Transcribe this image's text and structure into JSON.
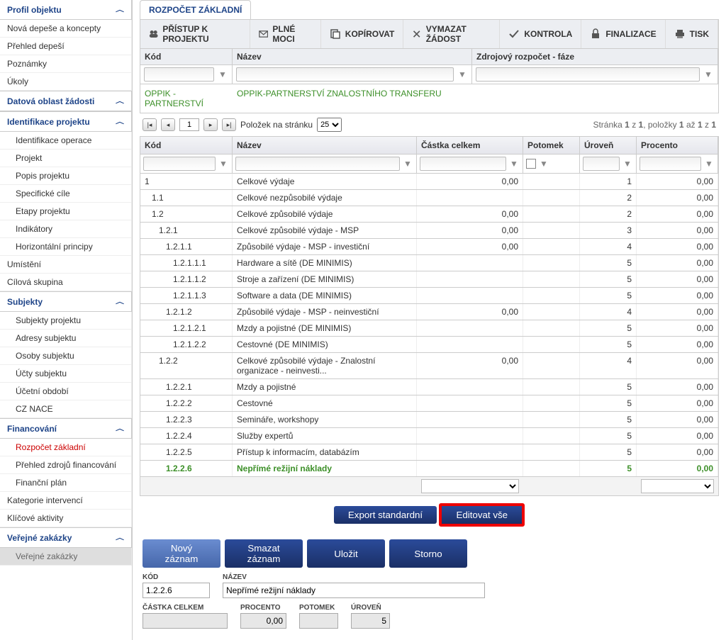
{
  "sidebar": {
    "sections": [
      {
        "label": "Profil objektu",
        "collapsible": true
      },
      {
        "items": [
          "Nová depeše a koncepty",
          "Přehled depeší",
          "Poznámky",
          "Úkoly"
        ]
      },
      {
        "label": "Datová oblast žádosti",
        "collapsible": true
      },
      {
        "label": "Identifikace projektu",
        "collapsible": true,
        "subitems": [
          "Identifikace operace",
          "Projekt",
          "Popis projektu",
          "Specifické cíle",
          "Etapy projektu",
          "Indikátory",
          "Horizontální principy"
        ]
      },
      {
        "plain": [
          "Umístění",
          "Cílová skupina"
        ]
      },
      {
        "label": "Subjekty",
        "collapsible": true,
        "subitems": [
          "Subjekty projektu",
          "Adresy subjektu",
          "Osoby subjektu",
          "Účty subjektu",
          "Účetní období",
          "CZ NACE"
        ]
      },
      {
        "label": "Financování",
        "collapsible": true,
        "subitems_html": [
          {
            "text": "Rozpočet základní",
            "active": true
          },
          {
            "text": "Přehled zdrojů financování"
          },
          {
            "text": "Finanční plán"
          }
        ]
      },
      {
        "plain": [
          "Kategorie intervencí",
          "Klíčové aktivity"
        ]
      },
      {
        "label": "Veřejné zakázky",
        "collapsible": true,
        "subitems_gray": [
          "Veřejné zakázky"
        ]
      }
    ]
  },
  "main": {
    "tab": "ROZPOČET ZÁKLADNÍ",
    "toolbar": [
      {
        "label": "PŘÍSTUP K PROJEKTU",
        "icon": "group"
      },
      {
        "label": "PLNÉ MOCI",
        "icon": "mail"
      },
      {
        "label": "KOPÍROVAT",
        "icon": "copy"
      },
      {
        "label": "VYMAZAT ŽÁDOST",
        "icon": "cross"
      },
      {
        "label": "KONTROLA",
        "icon": "check"
      },
      {
        "label": "FINALIZACE",
        "icon": "lock"
      },
      {
        "label": "TISK",
        "icon": "print"
      }
    ],
    "filter1": {
      "kod": "Kód",
      "nazev": "Název",
      "zdroj": "Zdrojový rozpočet - fáze"
    },
    "green": {
      "kod": "OPPIK - PARTNERSTVÍ",
      "nazev": "OPPIK-PARTNERSTVÍ ZNALOSTNÍHO TRANSFERU"
    },
    "pager": {
      "label": "Položek na stránku",
      "size": "25",
      "page": "1",
      "info_pre": "Stránka ",
      "b1": "1",
      "mid": " z ",
      "b2": "1",
      "mid2": ", položky ",
      "b3": "1",
      "mid3": " až ",
      "b4": "1",
      "mid4": " z ",
      "b5": "1"
    },
    "grid_headers": {
      "kod": "Kód",
      "nazev": "Název",
      "castka": "Částka celkem",
      "potomek": "Potomek",
      "uroven": "Úroveň",
      "procento": "Procento"
    },
    "rows": [
      {
        "kod": "1",
        "ind": 0,
        "nazev": "Celkové výdaje",
        "castka": "0,00",
        "uroven": "1",
        "proc": "0,00"
      },
      {
        "kod": "1.1",
        "ind": 1,
        "nazev": "Celkové nezpůsobilé výdaje",
        "castka": "",
        "uroven": "2",
        "proc": "0,00"
      },
      {
        "kod": "1.2",
        "ind": 1,
        "nazev": "Celkové způsobilé výdaje",
        "castka": "0,00",
        "uroven": "2",
        "proc": "0,00"
      },
      {
        "kod": "1.2.1",
        "ind": 2,
        "nazev": "Celkové způsobilé výdaje - MSP",
        "castka": "0,00",
        "uroven": "3",
        "proc": "0,00"
      },
      {
        "kod": "1.2.1.1",
        "ind": 3,
        "nazev": "Způsobilé výdaje - MSP - investiční",
        "castka": "0,00",
        "uroven": "4",
        "proc": "0,00"
      },
      {
        "kod": "1.2.1.1.1",
        "ind": 4,
        "nazev": "Hardware a sítě (DE MINIMIS)",
        "castka": "",
        "uroven": "5",
        "proc": "0,00"
      },
      {
        "kod": "1.2.1.1.2",
        "ind": 4,
        "nazev": "Stroje a zařízení (DE MINIMIS)",
        "castka": "",
        "uroven": "5",
        "proc": "0,00"
      },
      {
        "kod": "1.2.1.1.3",
        "ind": 4,
        "nazev": "Software a data (DE MINIMIS)",
        "castka": "",
        "uroven": "5",
        "proc": "0,00"
      },
      {
        "kod": "1.2.1.2",
        "ind": 3,
        "nazev": "Způsobilé výdaje - MSP - neinvestiční",
        "castka": "0,00",
        "uroven": "4",
        "proc": "0,00"
      },
      {
        "kod": "1.2.1.2.1",
        "ind": 4,
        "nazev": "Mzdy a pojistné (DE MINIMIS)",
        "castka": "",
        "uroven": "5",
        "proc": "0,00"
      },
      {
        "kod": "1.2.1.2.2",
        "ind": 4,
        "nazev": "Cestovné (DE MINIMIS)",
        "castka": "",
        "uroven": "5",
        "proc": "0,00"
      },
      {
        "kod": "1.2.2",
        "ind": 2,
        "nazev": "Celkové způsobilé výdaje - Znalostní organizace - neinvesti...",
        "castka": "0,00",
        "uroven": "4",
        "proc": "0,00"
      },
      {
        "kod": "1.2.2.1",
        "ind": 3,
        "nazev": "Mzdy a pojistné",
        "castka": "",
        "uroven": "5",
        "proc": "0,00"
      },
      {
        "kod": "1.2.2.2",
        "ind": 3,
        "nazev": "Cestovné",
        "castka": "",
        "uroven": "5",
        "proc": "0,00"
      },
      {
        "kod": "1.2.2.3",
        "ind": 3,
        "nazev": "Semináře, workshopy",
        "castka": "",
        "uroven": "5",
        "proc": "0,00"
      },
      {
        "kod": "1.2.2.4",
        "ind": 3,
        "nazev": "Služby expertů",
        "castka": "",
        "uroven": "5",
        "proc": "0,00"
      },
      {
        "kod": "1.2.2.5",
        "ind": 3,
        "nazev": "Přístup k informacím, databázím",
        "castka": "",
        "uroven": "5",
        "proc": "0,00"
      },
      {
        "kod": "1.2.2.6",
        "ind": 3,
        "nazev": "Nepřímé režijní náklady",
        "castka": "",
        "uroven": "5",
        "proc": "0,00",
        "sel": true
      }
    ],
    "buttons": {
      "export": "Export standardní",
      "edit": "Editovat vše",
      "novy": "Nový záznam",
      "smazat": "Smazat záznam",
      "ulozit": "Uložit",
      "storno": "Storno"
    },
    "form": {
      "kod_lbl": "KÓD",
      "kod": "1.2.2.6",
      "nazev_lbl": "NÁZEV",
      "nazev": "Nepřímé režijní náklady",
      "castka_lbl": "ČÁSTKA CELKEM",
      "castka": "",
      "procento_lbl": "PROCENTO",
      "procento": "0,00",
      "potomek_lbl": "POTOMEK",
      "uroven_lbl": "ÚROVEŇ",
      "uroven": "5"
    }
  }
}
